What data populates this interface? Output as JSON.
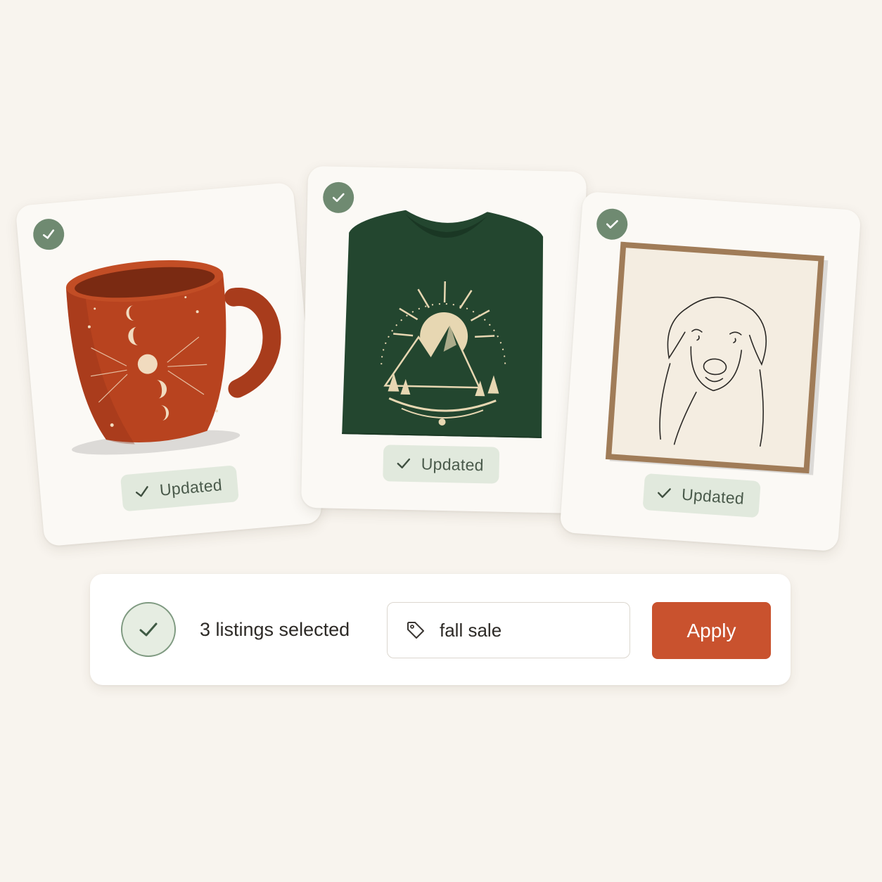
{
  "listings": [
    {
      "product": "moon phase mug",
      "status_label": "Updated",
      "selected": true
    },
    {
      "product": "sun mountain t-shirt",
      "status_label": "Updated",
      "selected": true
    },
    {
      "product": "dog line art print",
      "status_label": "Updated",
      "selected": true
    }
  ],
  "action_bar": {
    "selection_text": "3 listings selected",
    "tag_value": "fall sale",
    "apply_label": "Apply"
  },
  "colors": {
    "background": "#f8f4ee",
    "check_green": "#6f8a71",
    "pill_bg": "#e1e9dd",
    "apply": "#c9522e",
    "mug": "#b8431f",
    "shirt": "#23462f"
  },
  "icons": [
    "check-icon",
    "tag-icon"
  ]
}
